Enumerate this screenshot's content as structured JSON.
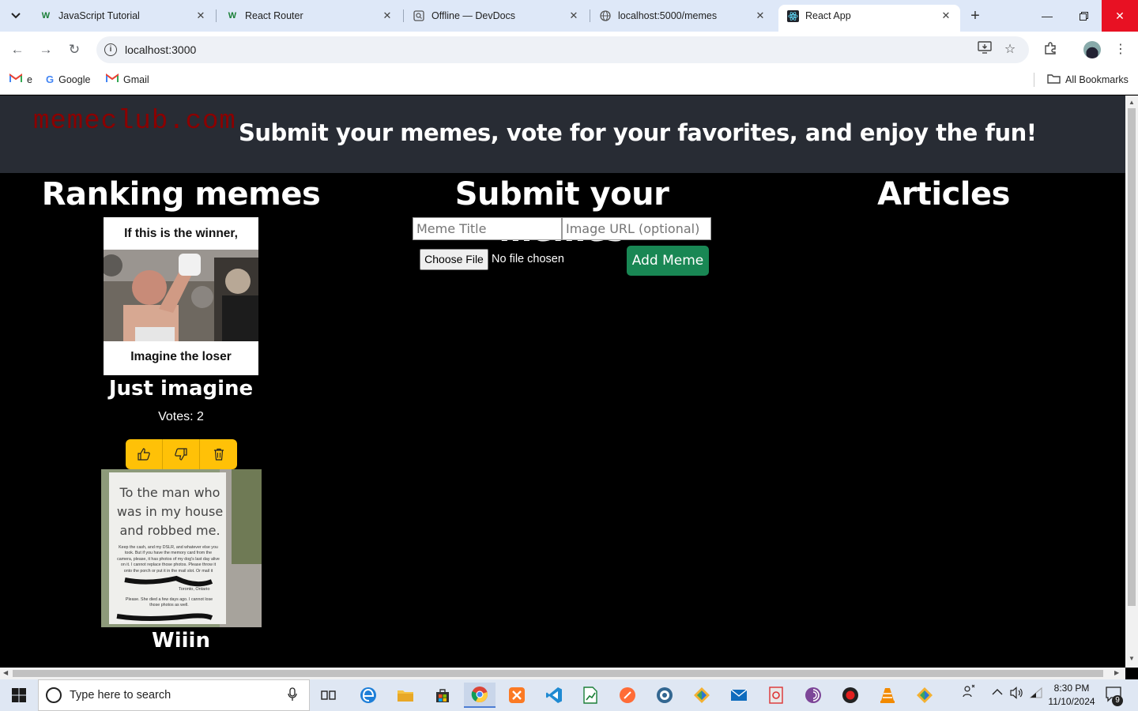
{
  "tabs": [
    {
      "title": "JavaScript Tutorial",
      "favicon": "W"
    },
    {
      "title": "React Router",
      "favicon": "W"
    },
    {
      "title": "Offline — DevDocs",
      "favicon": "Q"
    },
    {
      "title": "localhost:5000/memes",
      "favicon": "globe"
    },
    {
      "title": "React App",
      "favicon": "react"
    }
  ],
  "address": {
    "url": "localhost:3000"
  },
  "bookmarks": {
    "items": [
      {
        "label": "e"
      },
      {
        "label": "Google"
      },
      {
        "label": "Gmail"
      }
    ],
    "all_label": "All Bookmarks"
  },
  "header": {
    "logo": "memeclub.com",
    "tagline": "Submit your memes, vote for your favorites, and enjoy the fun!"
  },
  "ranking": {
    "title": "Ranking memes",
    "memes": [
      {
        "top_text": "If this is the winner,",
        "bottom_text": "Imagine the loser",
        "caption": "Just imagine",
        "votes_label": "Votes: 2"
      },
      {
        "note_lines": [
          "To the man who",
          "was in my house",
          "and robbed me."
        ],
        "small_text": "Keep the cash, and my DSLR, and whatever else you took. But if you have the memory card from the camera, please, it has photos of my dog's last day alive on it. I cannot replace those photos. Please throw it onto the porch or put it in the mail slot. Or mail it",
        "small_text_2": "Toronto, Ontario",
        "small_text_3": "Please. She died a few days ago. I cannot lose those photos as well.",
        "caption": "Wiiin"
      }
    ]
  },
  "submit": {
    "title": "Submit your memes",
    "title_placeholder": "Meme Title",
    "url_placeholder": "Image URL (optional)",
    "file_button": "Choose File",
    "file_status": "No file chosen",
    "add_button": "Add Meme"
  },
  "articles": {
    "title": "Articles"
  },
  "taskbar": {
    "search_placeholder": "Type here to search",
    "time": "8:30 PM",
    "date": "11/10/2024",
    "notification_count": "9"
  },
  "colors": {
    "header_bg": "#282c34",
    "logo": "#8b0000",
    "vote_btn": "#ffc107",
    "add_btn": "#198754"
  }
}
